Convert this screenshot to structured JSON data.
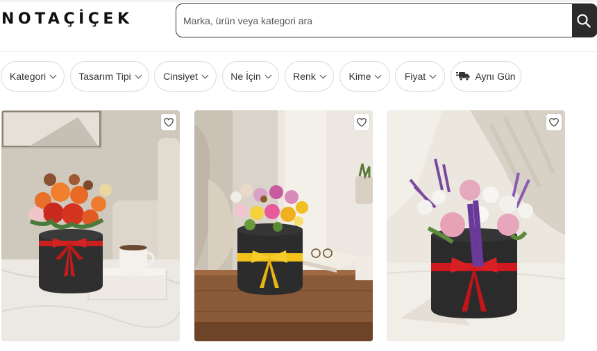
{
  "brand": {
    "logo_text": "NOTAÇİÇEK"
  },
  "search": {
    "placeholder": "Marka, ürün veya kategori ara"
  },
  "filters": [
    {
      "label": "Kategori"
    },
    {
      "label": "Tasarım Tipi"
    },
    {
      "label": "Cinsiyet"
    },
    {
      "label": "Ne İçin"
    },
    {
      "label": "Renk"
    },
    {
      "label": "Kime"
    },
    {
      "label": "Fiyat"
    },
    {
      "label": "Aynı Gün",
      "icon": "truck-icon"
    }
  ],
  "products": [
    {
      "image": "orange-roses-box-bouquet",
      "ribbon_color": "#c8201f"
    },
    {
      "image": "mixed-flowers-box-bouquet",
      "ribbon_color": "#f2c21a"
    },
    {
      "image": "pink-roses-lavender-box-bouquet",
      "ribbon_color": "#d01a20"
    }
  ]
}
